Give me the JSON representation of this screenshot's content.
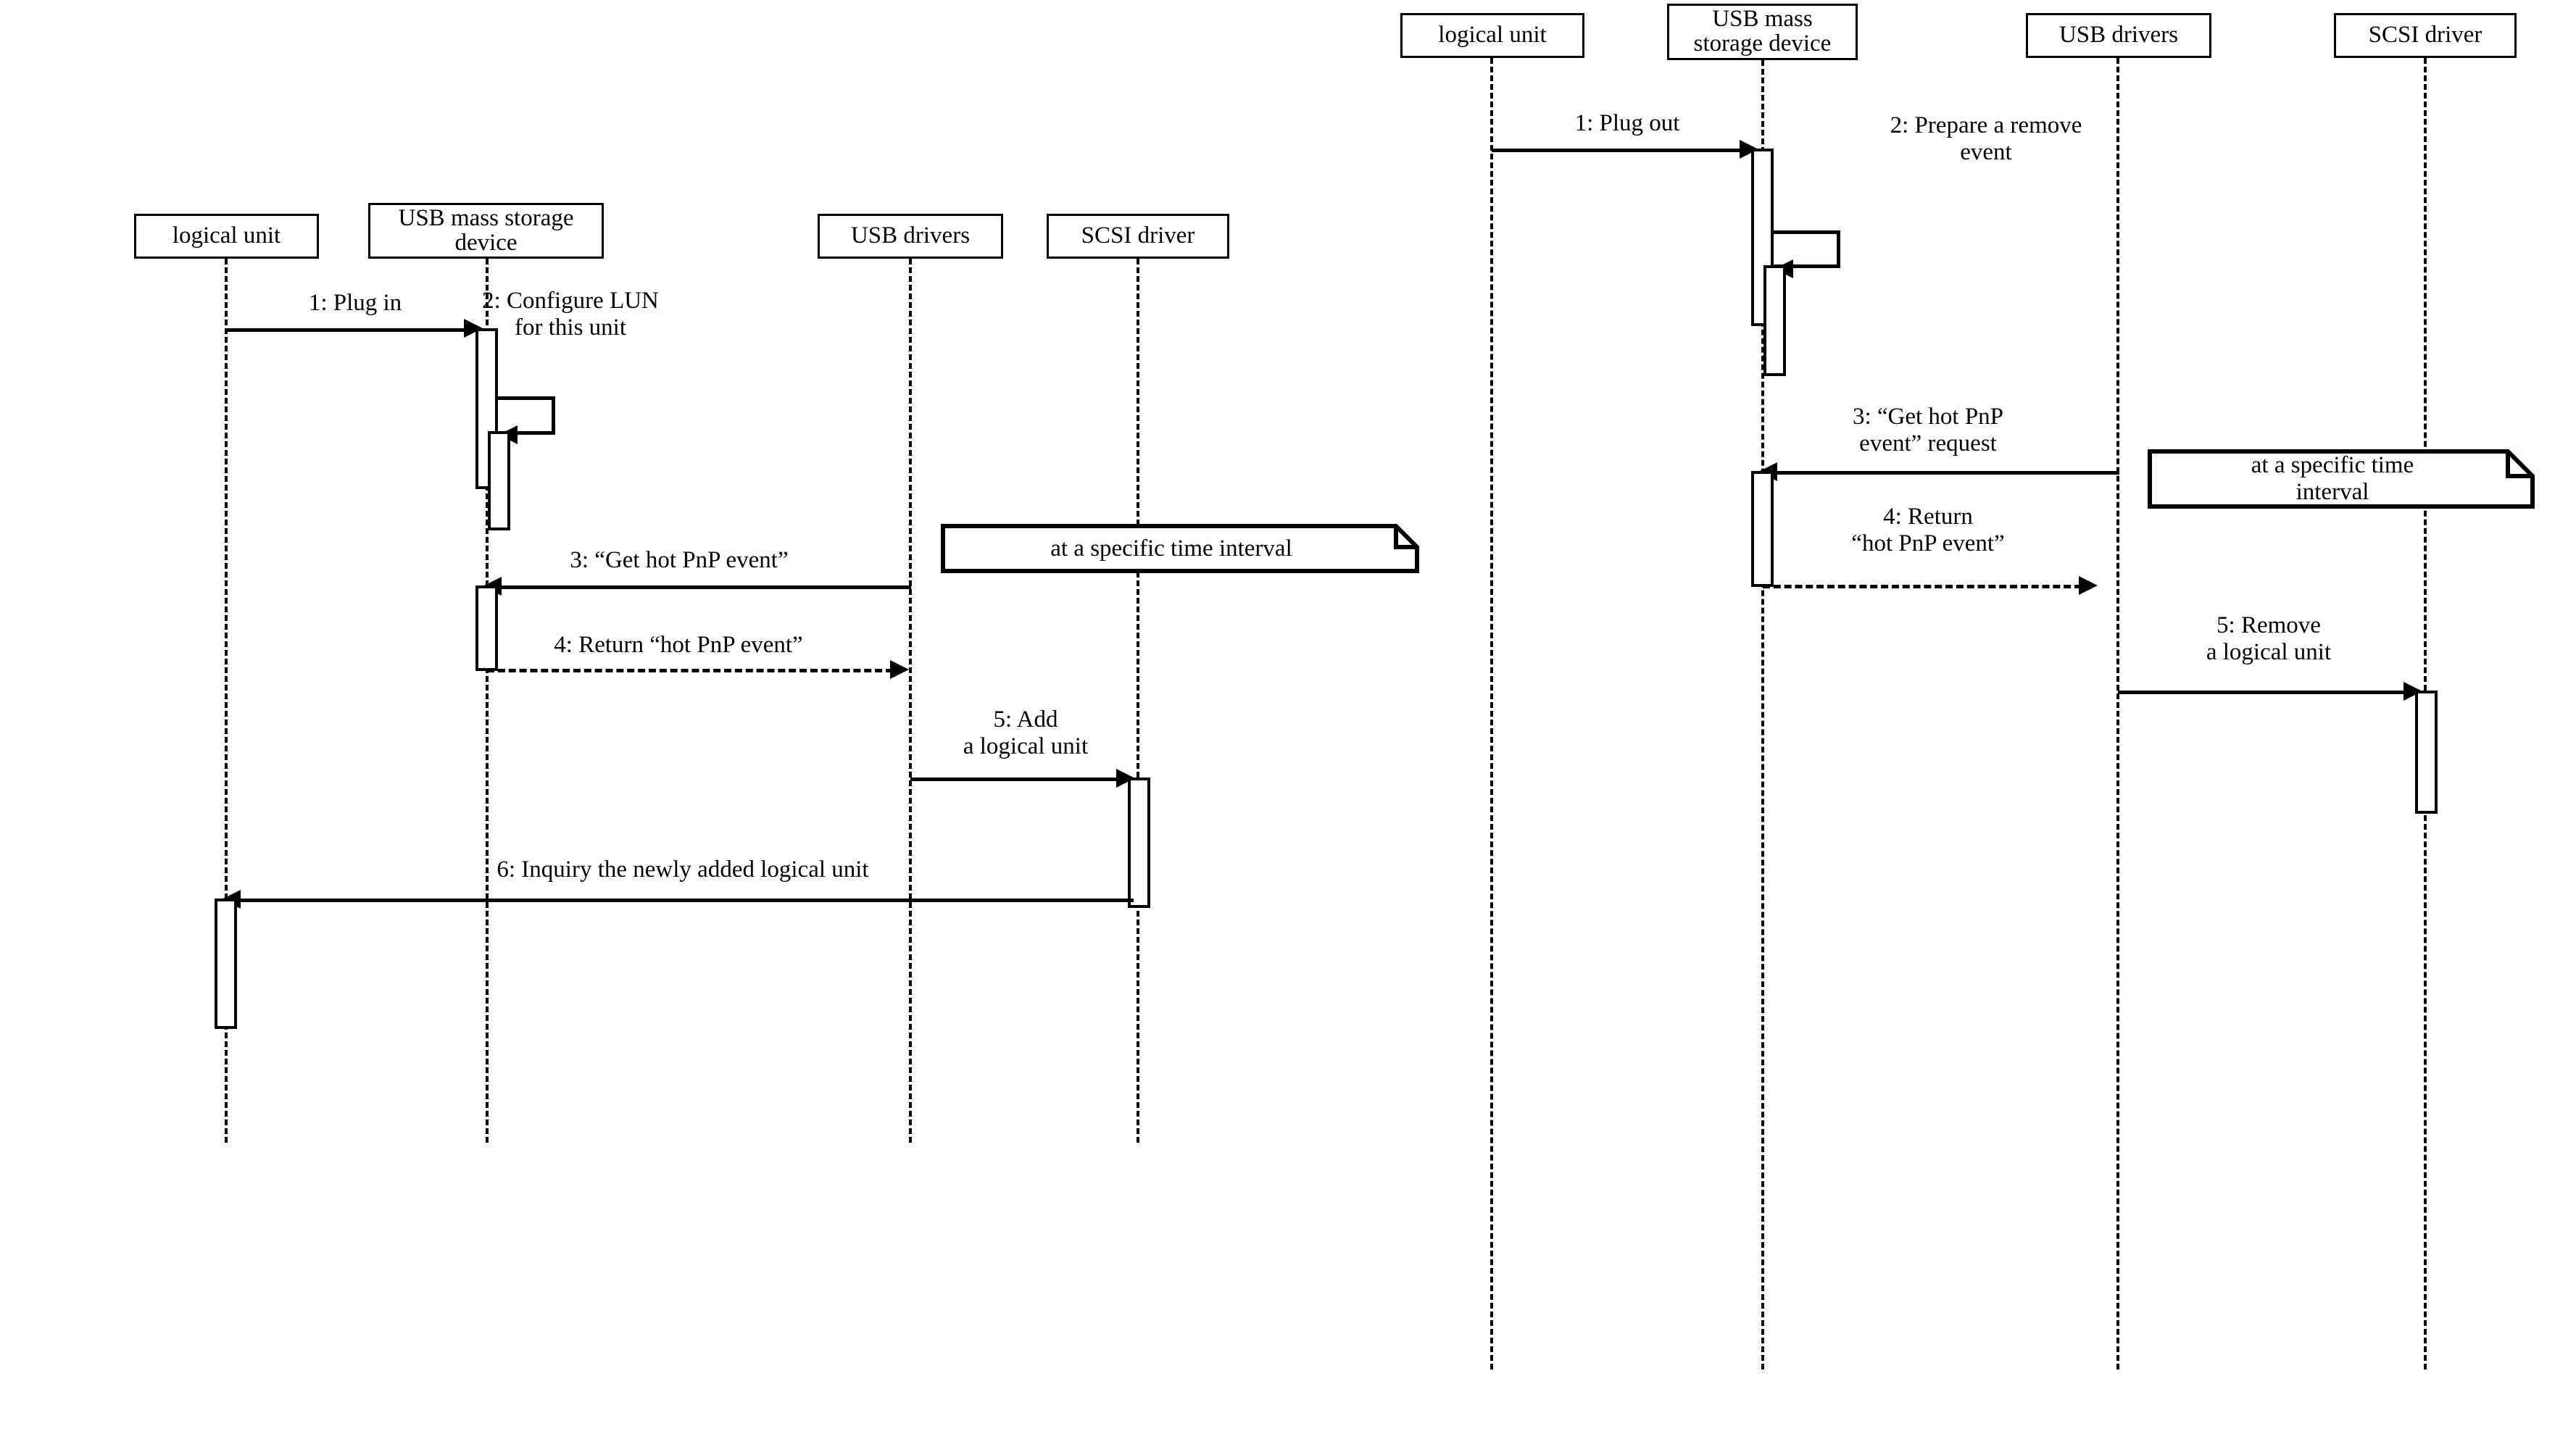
{
  "diagrams": [
    {
      "id": "plug-in",
      "lifelines": [
        {
          "name": "logical unit",
          "label": "logical unit"
        },
        {
          "name": "usb-mass-storage-device",
          "label": "USB mass storage\ndevice"
        },
        {
          "name": "usb-drivers",
          "label": "USB drivers"
        },
        {
          "name": "scsi-driver",
          "label": "SCSI driver"
        }
      ],
      "messages": [
        {
          "seq": "1",
          "label": "1: Plug in",
          "from": "logical unit",
          "to": "USB mass storage device",
          "kind": "call"
        },
        {
          "seq": "2",
          "label": "2: Configure LUN\nfor this unit",
          "from": "USB mass storage device",
          "to": "USB mass storage device",
          "kind": "self"
        },
        {
          "seq": "3",
          "label": "3: “Get hot PnP event”",
          "from": "USB drivers",
          "to": "USB mass storage device",
          "kind": "call"
        },
        {
          "seq": "4",
          "label": "4: Return “hot PnP event”",
          "from": "USB mass storage device",
          "to": "USB drivers",
          "kind": "return"
        },
        {
          "seq": "5",
          "label": "5: Add\na logical unit",
          "from": "USB drivers",
          "to": "SCSI driver",
          "kind": "call"
        },
        {
          "seq": "6",
          "label": "6: Inquiry the newly added logical unit",
          "from": "SCSI driver",
          "to": "logical unit",
          "kind": "call"
        }
      ],
      "notes": [
        {
          "text": "at a specific time interval"
        }
      ]
    },
    {
      "id": "plug-out",
      "lifelines": [
        {
          "name": "logical unit",
          "label": "logical unit"
        },
        {
          "name": "usb-mass-storage-device",
          "label": "USB mass\nstorage device"
        },
        {
          "name": "usb-drivers",
          "label": "USB drivers"
        },
        {
          "name": "scsi-driver",
          "label": "SCSI driver"
        }
      ],
      "messages": [
        {
          "seq": "1",
          "label": "1: Plug out",
          "from": "logical unit",
          "to": "USB mass storage device",
          "kind": "call"
        },
        {
          "seq": "2",
          "label": "2: Prepare a remove\nevent",
          "from": "USB mass storage device",
          "to": "USB mass storage device",
          "kind": "self"
        },
        {
          "seq": "3",
          "label": "3: “Get hot PnP\nevent” request",
          "from": "USB drivers",
          "to": "USB mass storage device",
          "kind": "call"
        },
        {
          "seq": "4",
          "label": "4: Return\n“hot PnP event”",
          "from": "USB mass storage device",
          "to": "USB drivers",
          "kind": "return"
        },
        {
          "seq": "5",
          "label": "5: Remove\na logical unit",
          "from": "USB drivers",
          "to": "SCSI driver",
          "kind": "call"
        }
      ],
      "notes": [
        {
          "text": "at a specific time\ninterval"
        }
      ]
    }
  ],
  "colors": {
    "stroke": "#000000",
    "background": "#ffffff"
  }
}
